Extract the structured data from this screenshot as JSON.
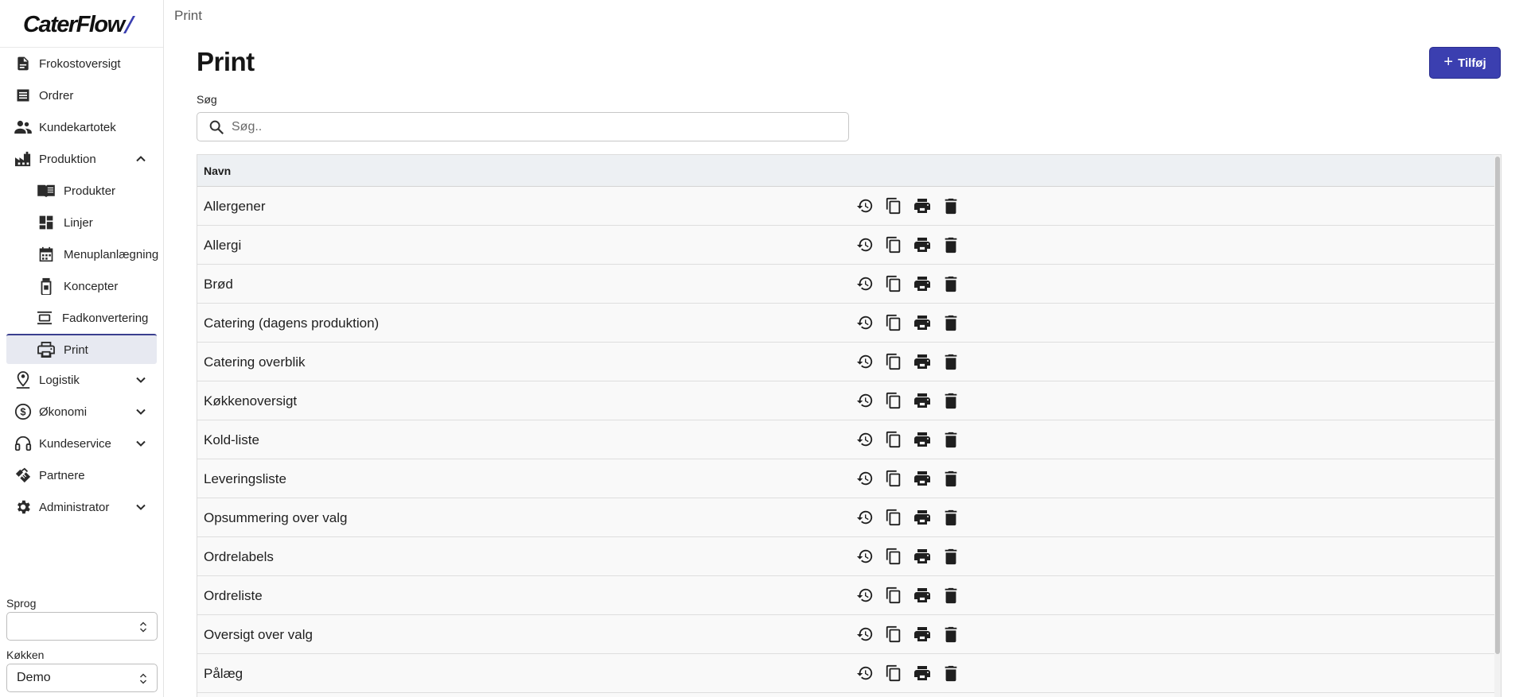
{
  "app": {
    "logo_text": "CaterFlow",
    "brand_color": "#3b3fb0"
  },
  "sidebar": {
    "items": [
      {
        "label": "Frokostoversigt",
        "icon": "document-icon"
      },
      {
        "label": "Ordrer",
        "icon": "receipt-icon"
      },
      {
        "label": "Kundekartotek",
        "icon": "people-icon"
      },
      {
        "label": "Produktion",
        "icon": "factory-icon",
        "expanded": true
      },
      {
        "label": "Logistik",
        "icon": "location-person-icon",
        "expanded": false
      },
      {
        "label": "Økonomi",
        "icon": "dollar-icon",
        "expanded": false
      },
      {
        "label": "Kundeservice",
        "icon": "headset-icon",
        "expanded": false
      },
      {
        "label": "Partnere",
        "icon": "handshake-icon"
      },
      {
        "label": "Administrator",
        "icon": "gear-icon",
        "expanded": false
      }
    ],
    "production_subitems": [
      {
        "label": "Produkter",
        "icon": "book-icon"
      },
      {
        "label": "Linjer",
        "icon": "dashboard-icon"
      },
      {
        "label": "Menuplanlægning",
        "icon": "calendar-icon"
      },
      {
        "label": "Koncepter",
        "icon": "jar-icon"
      },
      {
        "label": "Fadkonvertering",
        "icon": "layers-icon"
      },
      {
        "label": "Print",
        "icon": "printer-icon",
        "active": true
      }
    ],
    "language_label": "Sprog",
    "language_value": "",
    "kitchen_label": "Køkken",
    "kitchen_value": "Demo"
  },
  "breadcrumb": "Print",
  "page": {
    "title": "Print",
    "add_label": "Tilføj"
  },
  "search": {
    "label": "Søg",
    "placeholder": "Søg..",
    "value": ""
  },
  "table": {
    "column_name": "Navn",
    "rows": [
      "Allergener",
      "Allergi",
      "Brød",
      "Catering (dagens produktion)",
      "Catering overblik",
      "Køkkenoversigt",
      "Kold-liste",
      "Leveringsliste",
      "Opsummering over valg",
      "Ordrelabels",
      "Ordreliste",
      "Oversigt over valg",
      "Pålæg"
    ],
    "row_actions": [
      "history-icon",
      "copy-icon",
      "printer-icon",
      "trash-icon"
    ]
  }
}
